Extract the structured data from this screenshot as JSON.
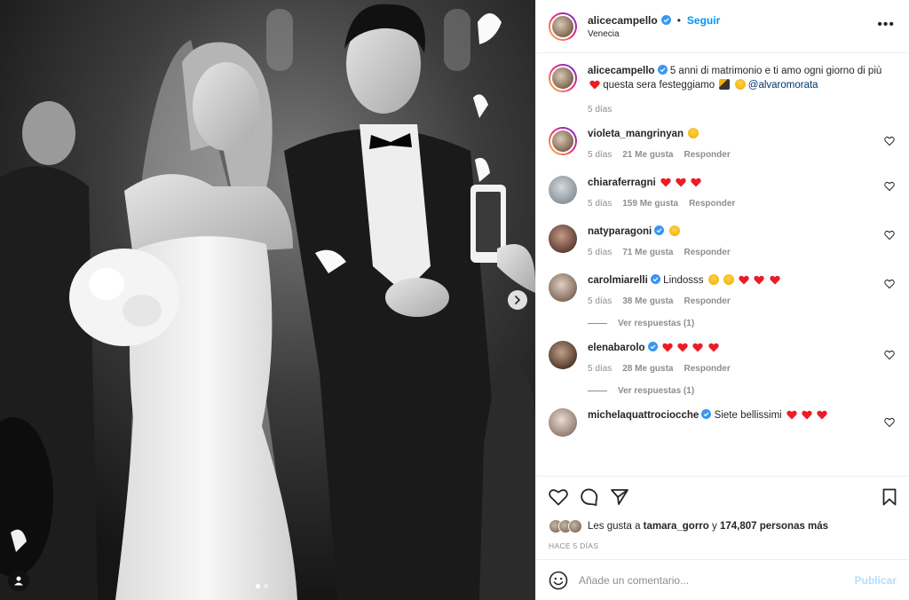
{
  "post": {
    "author": {
      "username": "alicecampello",
      "location": "Venecia",
      "follow_label": "Seguir",
      "separator": "•",
      "more_label": "•••"
    },
    "caption": {
      "username": "alicecampello",
      "text_part1": "5 anni di matrimonio e ti amo ogni giorno di più",
      "text_part2": "questa sera festeggiamo",
      "mention": "@alvaromorata",
      "age": "5 días"
    },
    "comments": [
      {
        "username": "violeta_mangrinyan",
        "verified": false,
        "text": "",
        "emoji": [
          "face"
        ],
        "age": "5 días",
        "likes": "21 Me gusta",
        "reply": "Responder"
      },
      {
        "username": "chiaraferragni",
        "verified": false,
        "text": "",
        "emoji": [
          "heart",
          "heart",
          "heart"
        ],
        "age": "5 días",
        "likes": "159 Me gusta",
        "reply": "Responder"
      },
      {
        "username": "natyparagoni",
        "verified": true,
        "text": "",
        "emoji": [
          "face"
        ],
        "age": "5 días",
        "likes": "71 Me gusta",
        "reply": "Responder"
      },
      {
        "username": "carolmiarelli",
        "verified": true,
        "text": "Lindosss",
        "emoji": [
          "face",
          "face",
          "heart",
          "heart",
          "heart"
        ],
        "age": "5 días",
        "likes": "38 Me gusta",
        "reply": "Responder",
        "view_replies": "Ver respuestas (1)"
      },
      {
        "username": "elenabarolo",
        "verified": true,
        "text": "",
        "emoji": [
          "heart",
          "heart",
          "heart",
          "heart"
        ],
        "age": "5 días",
        "likes": "28 Me gusta",
        "reply": "Responder",
        "view_replies": "Ver respuestas (1)"
      },
      {
        "username": "michelaquattrociocche",
        "verified": true,
        "text": "Siete bellissimi",
        "emoji": [
          "heart",
          "heart",
          "heart"
        ]
      }
    ],
    "likes": {
      "prefix": "Les gusta a",
      "first_user": "tamara_gorro",
      "connector": "y",
      "count": "174,807 personas más"
    },
    "time_ago": "HACE 5 DÍAS",
    "add_comment": {
      "placeholder": "Añade un comentario...",
      "publish_label": "Publicar"
    }
  },
  "colors": {
    "link_blue": "#0095f6",
    "publish_disabled": "#b2dffc",
    "heart_red": "#ed1c24",
    "verified_blue": "#3897f0",
    "muted_text": "#8e8e8e"
  },
  "icons": [
    "heart-icon",
    "comment-icon",
    "share-icon",
    "bookmark-icon",
    "emoji-icon",
    "chevron-right-icon",
    "user-tag-icon",
    "verified-icon",
    "more-options-icon"
  ]
}
